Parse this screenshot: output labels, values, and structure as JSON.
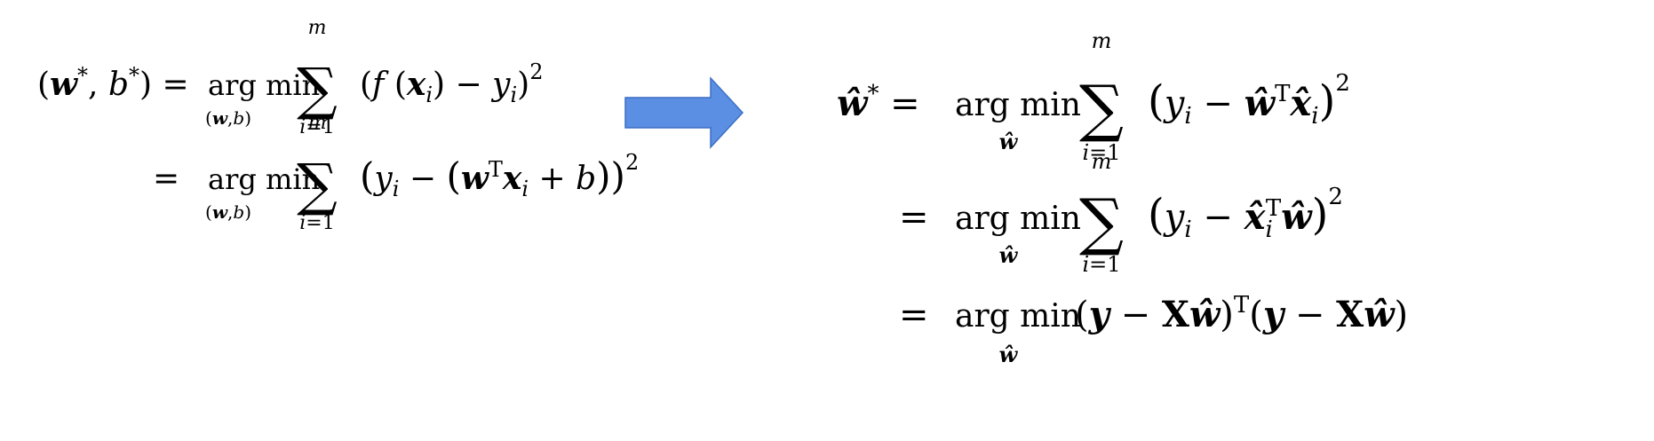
{
  "arrow_color": "#5b8fe3",
  "arrow_stroke": "#3c6fc4",
  "left": {
    "line1": {
      "lhs": "(w*, b*)",
      "op": "arg min",
      "sub": "(w,b)",
      "sum_top": "m",
      "sum_bottom": "i=1",
      "body": "(f (x_i) − y_i)^2"
    },
    "line2": {
      "op": "arg min",
      "sub": "(w,b)",
      "sum_top": "m",
      "sum_bottom": "i=1",
      "body": "(y_i − (w^T x_i + b))^2"
    }
  },
  "right": {
    "line1": {
      "lhs": "ŵ*",
      "op": "arg min",
      "sub": "ŵ",
      "sum_top": "m",
      "sum_bottom": "i=1",
      "body": "(y_i − ŵ^T x̂_i)^2"
    },
    "line2": {
      "op": "arg min",
      "sub": "ŵ",
      "sum_top": "m",
      "sum_bottom": "i=1",
      "body": "(y_i − x̂_i^T ŵ)^2"
    },
    "line3": {
      "op": "arg min",
      "sub": "ŵ",
      "body": "(y − Xŵ)^T (y − Xŵ)"
    }
  }
}
